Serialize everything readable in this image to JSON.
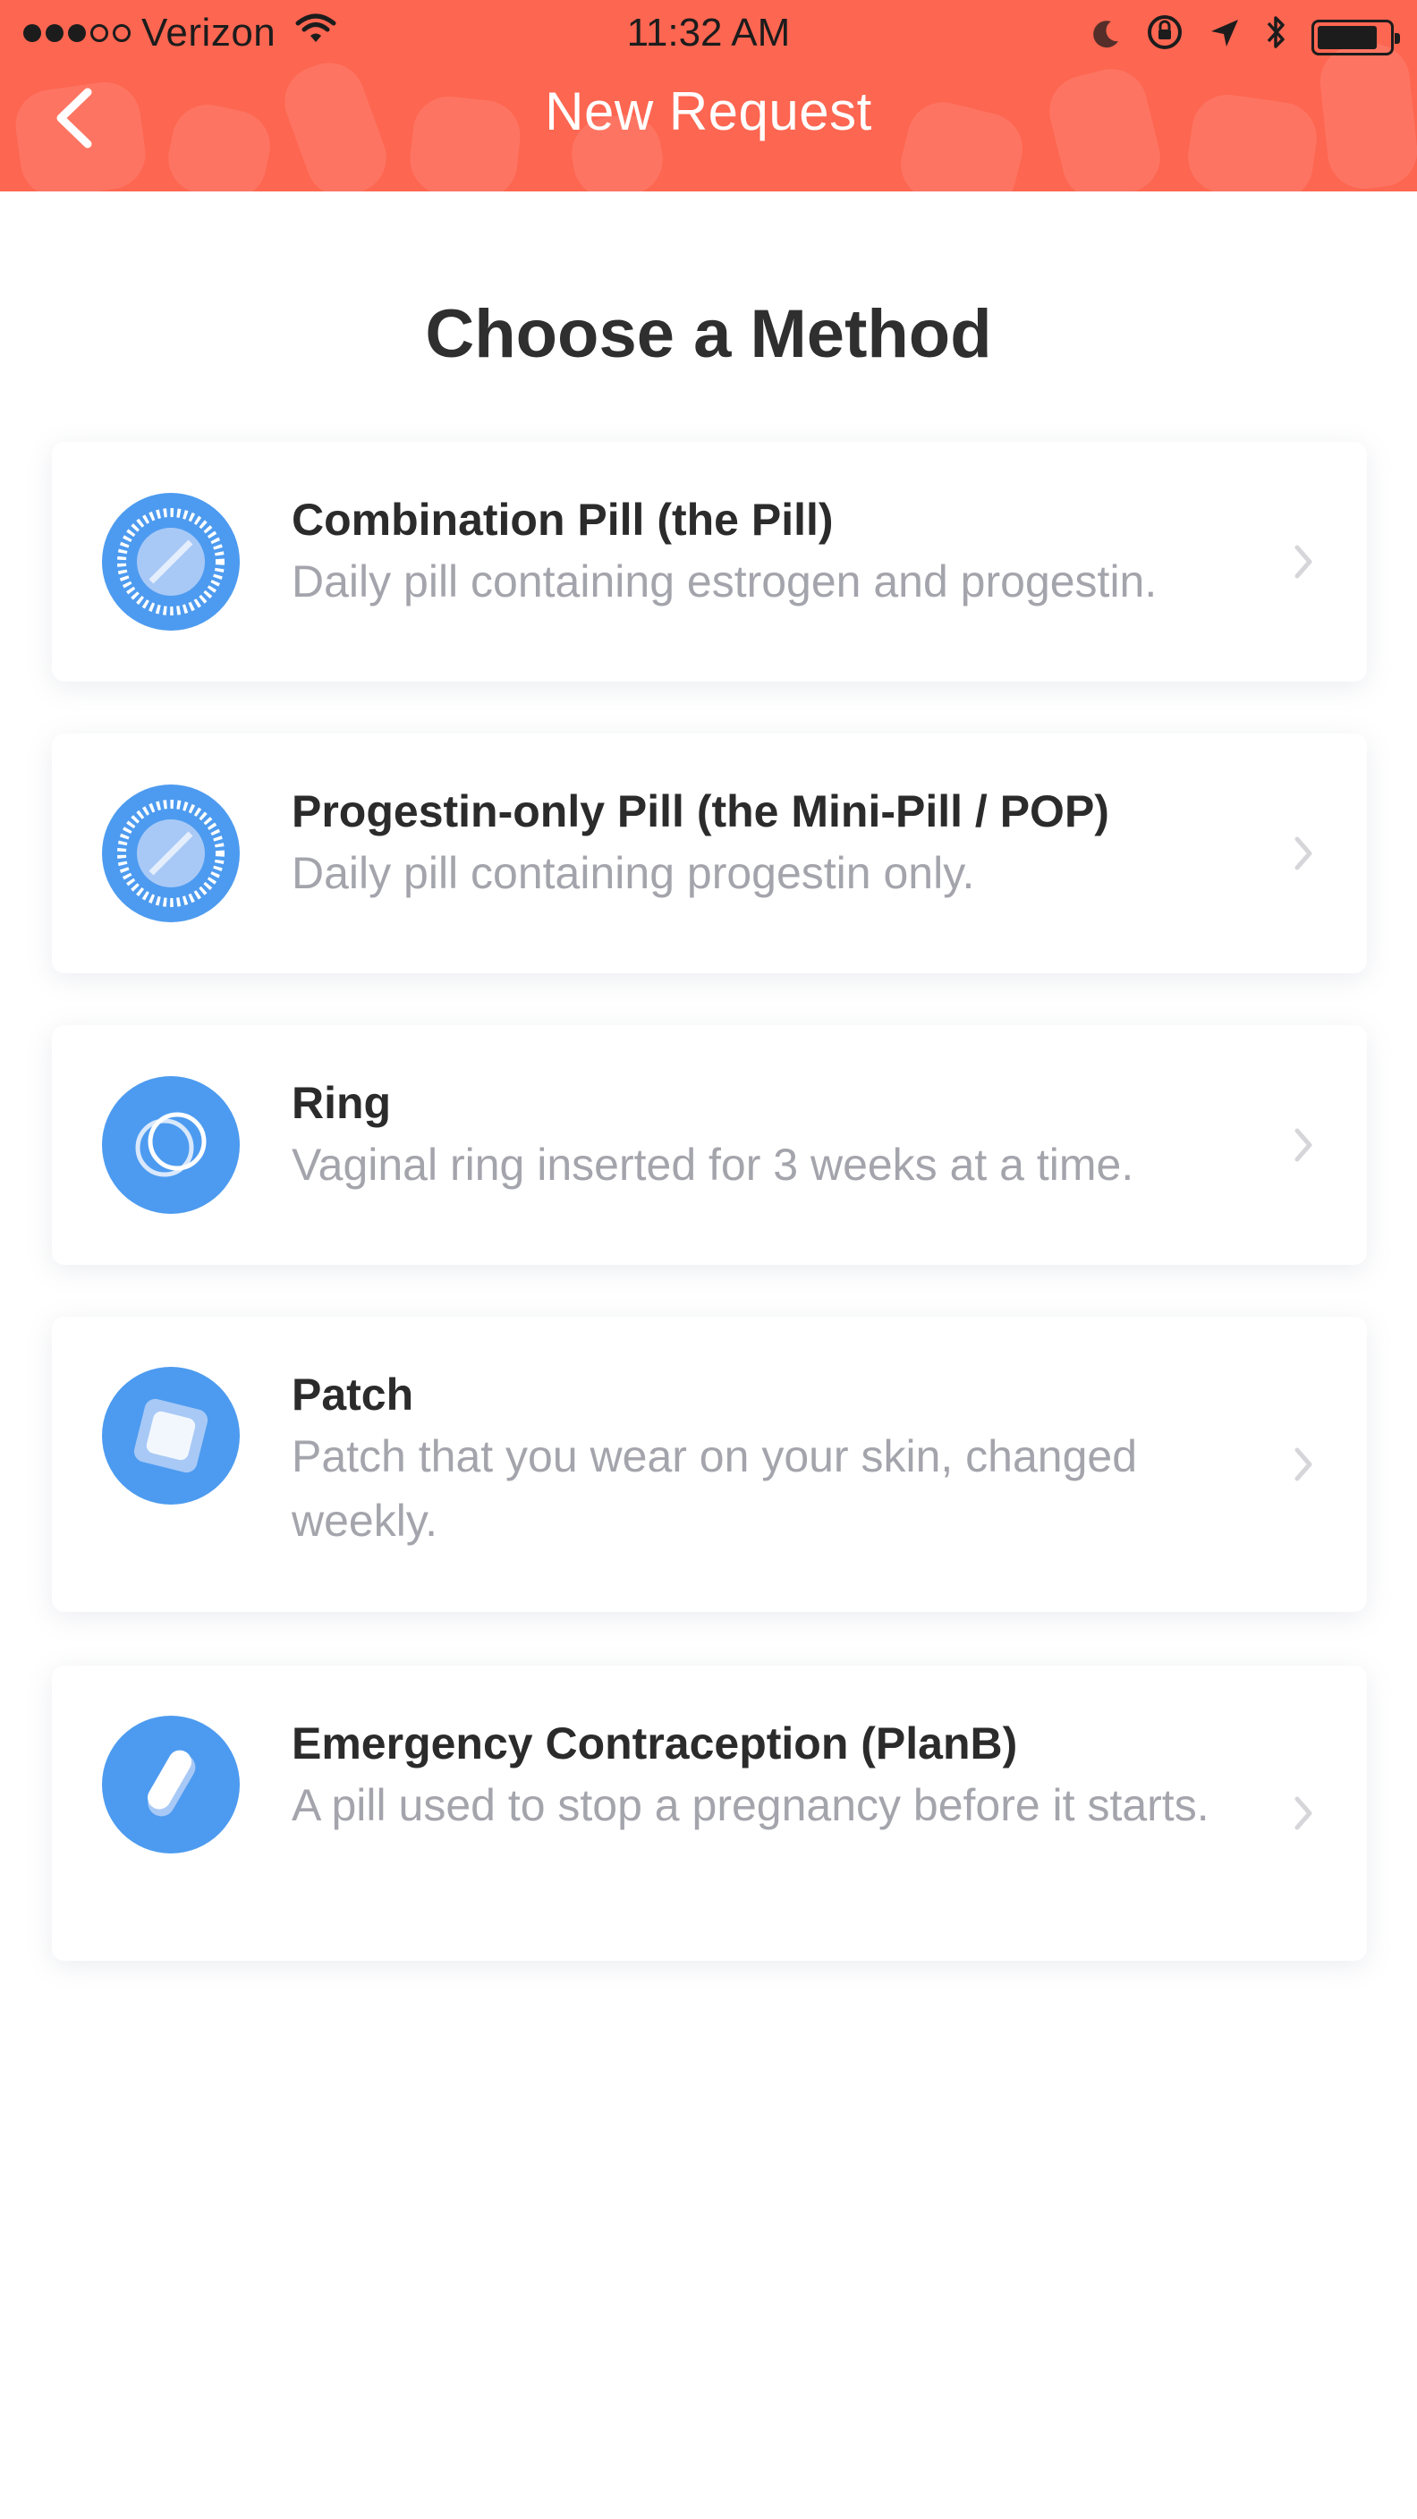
{
  "status_bar": {
    "carrier": "Verizon",
    "time": "11:32 AM",
    "battery_level": 0.85,
    "signal_bars_filled": 3,
    "signal_bars_total": 5
  },
  "nav": {
    "title": "New Request",
    "back_icon": "chevron-left-icon"
  },
  "page": {
    "title": "Choose a Method"
  },
  "methods": [
    {
      "title": "Combination Pill (the Pill)",
      "description": "Daily pill containing estrogen and progestin.",
      "icon": "pill-pack-icon"
    },
    {
      "title": "Progestin-only Pill (the Mini-Pill / POP)",
      "description": "Daily pill containing progestin only.",
      "icon": "pill-pack-icon"
    },
    {
      "title": "Ring",
      "description": "Vaginal ring inserted for 3 weeks at a time.",
      "icon": "ring-icon"
    },
    {
      "title": "Patch",
      "description": "Patch that you wear on your skin, changed weekly.",
      "icon": "patch-icon"
    },
    {
      "title": "Emergency Contraception (PlanB)",
      "description": "A pill used to stop a pregnancy before it starts.",
      "icon": "capsule-icon"
    }
  ],
  "colors": {
    "header": "#fd6651",
    "icon_blue": "#4d9bf0",
    "title_text": "#2b2b2b",
    "desc_text": "#a4a4ac"
  }
}
